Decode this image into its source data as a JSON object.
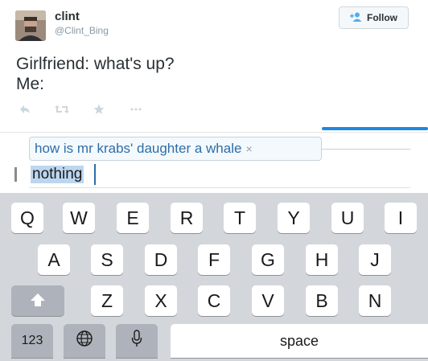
{
  "tweet": {
    "display_name": "clint",
    "handle": "@Clint_Bing",
    "follow_label": "Follow",
    "text_line1": "Girlfriend: what's up?",
    "text_line2": "Me:"
  },
  "compose": {
    "suggestion": "how is mr krabs' daughter a whale",
    "suggestion_close": "×",
    "typed": "nothing"
  },
  "keyboard": {
    "row1": [
      "Q",
      "W",
      "E",
      "R",
      "T",
      "Y",
      "U",
      "I"
    ],
    "row2": [
      "A",
      "S",
      "D",
      "F",
      "G",
      "H",
      "J"
    ],
    "row3": [
      "Z",
      "X",
      "C",
      "V",
      "B",
      "N"
    ],
    "numbers_label": "123",
    "space_label": "space"
  },
  "icons": {
    "follow": "person-add-icon",
    "reply": "reply-icon",
    "retweet": "retweet-icon",
    "favorite": "star-icon",
    "more": "more-icon",
    "shift": "shift-arrow-icon",
    "globe": "globe-icon",
    "mic": "microphone-icon"
  },
  "colors": {
    "accent": "#1e88e5",
    "suggestion_text": "#2d6ea8",
    "keyboard_bg": "#d3d6db"
  }
}
